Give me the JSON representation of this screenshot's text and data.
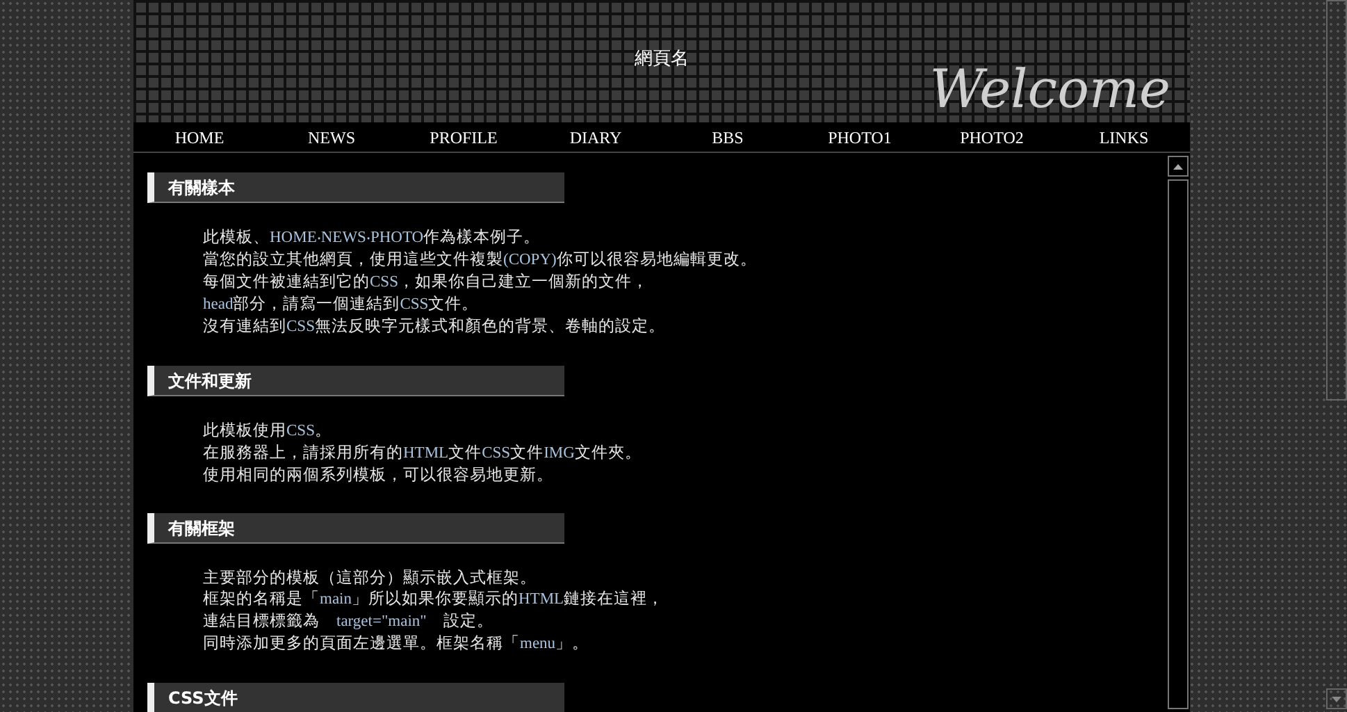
{
  "header": {
    "site_name": "網頁名",
    "welcome": "Welcome"
  },
  "nav": [
    "HOME",
    "NEWS",
    "PROFILE",
    "DIARY",
    "BBS",
    "PHOTO1",
    "PHOTO2",
    "LINKS"
  ],
  "sections": [
    {
      "title": "有關樣本",
      "lines": [
        [
          {
            "kind": "plain",
            "text": "此模板、"
          },
          {
            "kind": "term",
            "text": "HOME‧NEWS‧PHOTO"
          },
          {
            "kind": "plain",
            "text": "作為樣本例子。"
          }
        ],
        [
          {
            "kind": "plain",
            "text": "當您的設立其他網頁，使用這些文件複製"
          },
          {
            "kind": "term",
            "text": "(COPY)"
          },
          {
            "kind": "plain",
            "text": "你可以很容易地編輯更改。"
          }
        ],
        [
          {
            "kind": "plain",
            "text": "每個文件被連結到它的"
          },
          {
            "kind": "term",
            "text": "CSS"
          },
          {
            "kind": "plain",
            "text": "，如果你自己建立一個新的文件，"
          }
        ],
        [
          {
            "kind": "term",
            "text": "head"
          },
          {
            "kind": "plain",
            "text": "部分，請寫一個連結到"
          },
          {
            "kind": "term",
            "text": "CSS"
          },
          {
            "kind": "plain",
            "text": "文件。"
          }
        ],
        [
          {
            "kind": "plain",
            "text": "沒有連結到"
          },
          {
            "kind": "term",
            "text": "CSS"
          },
          {
            "kind": "plain",
            "text": "無法反映字元樣式和顏色的背景、卷軸的設定。"
          }
        ]
      ]
    },
    {
      "title": "文件和更新",
      "lines": [
        [
          {
            "kind": "plain",
            "text": "此模板使用"
          },
          {
            "kind": "term",
            "text": "CSS"
          },
          {
            "kind": "plain",
            "text": "。"
          }
        ],
        [
          {
            "kind": "plain",
            "text": "在服務器上，請採用所有的"
          },
          {
            "kind": "term",
            "text": "HTML"
          },
          {
            "kind": "plain",
            "text": "文件"
          },
          {
            "kind": "term",
            "text": "CSS"
          },
          {
            "kind": "plain",
            "text": "文件"
          },
          {
            "kind": "term",
            "text": "IMG"
          },
          {
            "kind": "plain",
            "text": "文件夾。"
          }
        ],
        [
          {
            "kind": "plain",
            "text": "使用相同的兩個系列模板，可以很容易地更新。"
          }
        ]
      ]
    },
    {
      "title": "有關框架",
      "lines": [
        [
          {
            "kind": "plain",
            "text": "主要部分的模板（這部分）顯示嵌入式框架。"
          }
        ],
        [
          {
            "kind": "plain",
            "text": "框架的名稱是「"
          },
          {
            "kind": "term",
            "text": "main"
          },
          {
            "kind": "plain",
            "text": "」所以如果你要顯示的"
          },
          {
            "kind": "term",
            "text": "HTML"
          },
          {
            "kind": "plain",
            "text": "鏈接在這裡，"
          }
        ],
        [
          {
            "kind": "plain",
            "text": "連結目標標籤為　"
          },
          {
            "kind": "term",
            "text": "target=\"main\""
          },
          {
            "kind": "plain",
            "text": "　設定。"
          }
        ],
        [
          {
            "kind": "plain",
            "text": "同時添加更多的頁面左邊選單。框架名稱「"
          },
          {
            "kind": "term",
            "text": "menu"
          },
          {
            "kind": "plain",
            "text": "」。"
          }
        ]
      ]
    },
    {
      "title": "CSS文件"
    }
  ]
}
